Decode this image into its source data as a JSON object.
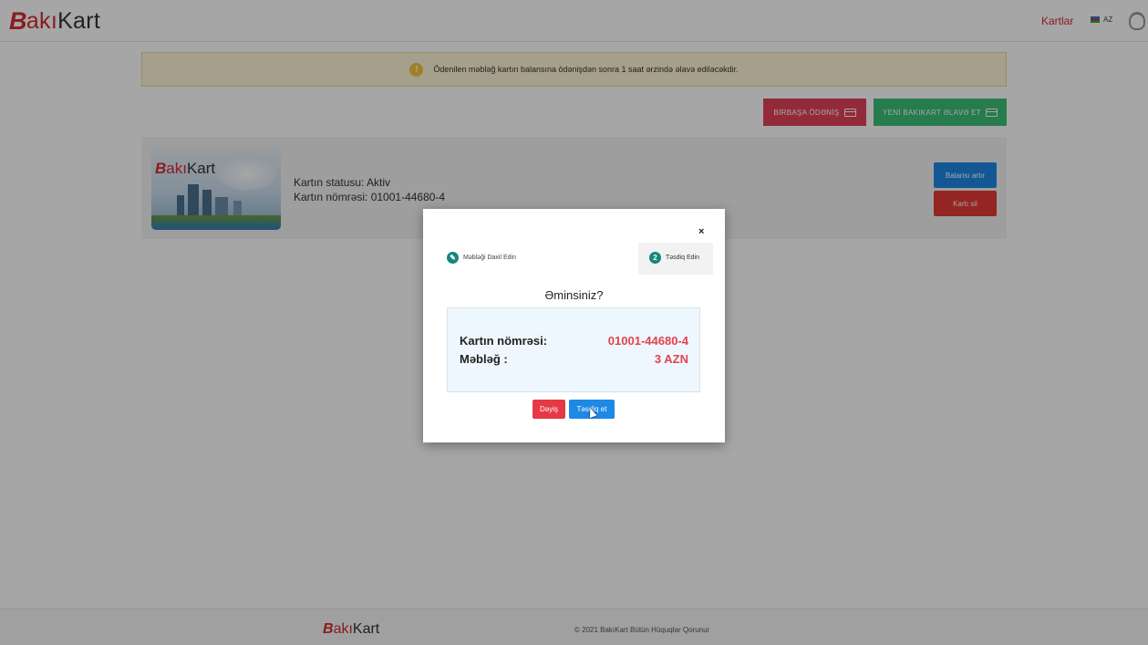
{
  "header": {
    "logo_mark": "B",
    "logo_mid": "akı",
    "logo_end": "Kart",
    "nav_cards": "Kartlar",
    "lang": "AZ"
  },
  "notice": {
    "icon": "!",
    "text": "Ödenilen məbləğ kartın balansına ödənişdən sonra 1 saat ərzində əlavə ediləcəkdir."
  },
  "toolbar": {
    "direct_payment": "BİRBAŞA ÖDƏNİŞ",
    "add_new_card": "YENİ BAKIKART ƏLAVƏ ET"
  },
  "card": {
    "logo_mark": "B",
    "logo_mid": "akı",
    "logo_end": "Kart",
    "status": "Kartın statusu: Aktiv",
    "number": "Kartın nömrəsi: 01001-44680-4",
    "topup_label": "Balansı artır",
    "delete_label": "Kartı sil"
  },
  "modal": {
    "close": "×",
    "step1_label": "Məbləği Daxil Edin",
    "step2_number": "2",
    "step2_label": "Təsdiq Edin",
    "title": "Əminsiniz?",
    "card_number_label": "Kartın nömrəsi:",
    "card_number_value": "01001-44680-4",
    "amount_label": "Məbləğ :",
    "amount_value": "3 AZN",
    "change_label": "Dəyiş",
    "confirm_label": "Təsdiq et"
  },
  "footer": {
    "logo_mark": "B",
    "logo_mid": "akı",
    "logo_end": "Kart",
    "copyright": "© 2021 BakıKart Bütün Hüquqlar Qorunur"
  },
  "colors": {
    "brand_red": "#d42b32",
    "primary_blue": "#1e88e5",
    "success_green": "#3bbf76",
    "step_teal": "#19867a"
  }
}
